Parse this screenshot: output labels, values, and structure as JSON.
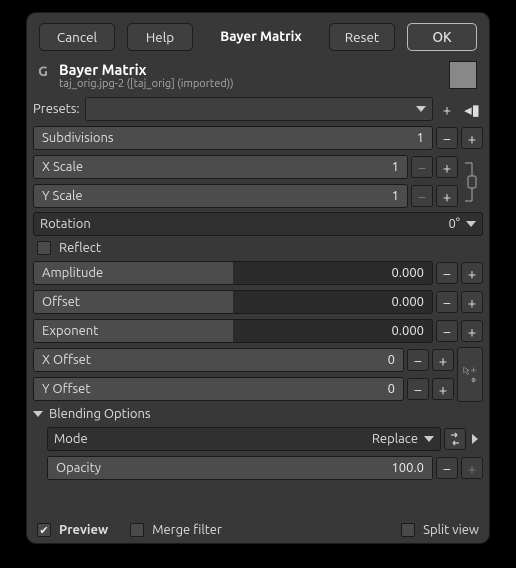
{
  "buttons": {
    "cancel": "Cancel",
    "help": "Help",
    "title": "Bayer Matrix",
    "reset": "Reset",
    "ok": "OK"
  },
  "header": {
    "title": "Bayer Matrix",
    "subtitle": "taj_orig.jpg-2 ([taj_orig] (imported))"
  },
  "presets_label": "Presets:",
  "params": {
    "subdivisions": {
      "label": "Subdivisions",
      "value": "1"
    },
    "xscale": {
      "label": "X Scale",
      "value": "1"
    },
    "yscale": {
      "label": "Y Scale",
      "value": "1"
    },
    "rotation": {
      "label": "Rotation",
      "value": "0°"
    },
    "reflect": {
      "label": "Reflect",
      "checked": false
    },
    "amplitude": {
      "label": "Amplitude",
      "value": "0.000"
    },
    "offset": {
      "label": "Offset",
      "value": "0.000"
    },
    "exponent": {
      "label": "Exponent",
      "value": "0.000"
    },
    "xoffset": {
      "label": "X Offset",
      "value": "0"
    },
    "yoffset": {
      "label": "Y Offset",
      "value": "0"
    }
  },
  "blending": {
    "header": "Blending Options",
    "mode_label": "Mode",
    "mode_value": "Replace",
    "opacity_label": "Opacity",
    "opacity_value": "100.0"
  },
  "footer": {
    "preview": "Preview",
    "merge": "Merge filter",
    "split": "Split view"
  }
}
